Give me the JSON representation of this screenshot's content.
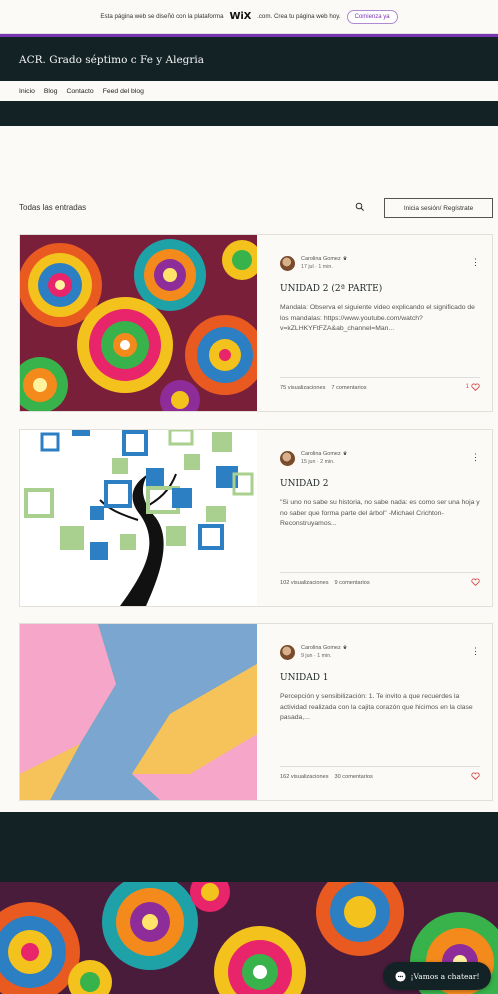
{
  "wix_banner": {
    "text": "Esta página web se diseñó con la plataforma",
    "brand": "WiX",
    "brand_suffix": ".com. Crea tu página web hoy.",
    "cta": "Comienza ya"
  },
  "header": {
    "site_title": "ACR. Grado séptimo c Fe y Alegria",
    "nav": [
      "Inicio",
      "Blog",
      "Contacto",
      "Feed del blog"
    ]
  },
  "blog": {
    "all_posts_label": "Todas las entradas",
    "login_label": "Inicia sesión/ Regístrate"
  },
  "posts": [
    {
      "author": "Carolina Gomez",
      "date": "17 jul",
      "read_time": "1 min.",
      "title": "UNIDAD 2 (2ª PARTE)",
      "excerpt": "Mandala: Observa el siguiente video explicando el significado de los mandalas: https://www.youtube.com/watch?v=kZLHKYFtFZA&ab_channel=Man...",
      "views": "75 visualizaciones",
      "comments": "7 comentarios",
      "likes": "1"
    },
    {
      "author": "Carolina Gomez",
      "date": "15 jun",
      "read_time": "2 min.",
      "title": "UNIDAD 2",
      "excerpt": "\"Si uno no sabe su historia, no sabe nada: es como ser una hoja y no saber que forma parte del árbol\" -Michael Crichton- Reconstruyamos...",
      "views": "102 visualizaciones",
      "comments": "9 comentarios",
      "likes": ""
    },
    {
      "author": "Carolina Gomez",
      "date": "9 jun",
      "read_time": "1 min.",
      "title": "UNIDAD 1",
      "excerpt": "Percepción y sensibilización: 1. Te invito a que recuerdes la actividad realizada con la cajita corazón que hicimos en la clase pasada,...",
      "views": "162 visualizaciones",
      "comments": "30 comentarios",
      "likes": ""
    }
  ],
  "chat": {
    "label": "¡Vamos a chatear!"
  },
  "colors": {
    "dark": "#132325",
    "accent": "#7a35b2",
    "heart": "#d64d4d",
    "background": "#fbfaf6"
  }
}
